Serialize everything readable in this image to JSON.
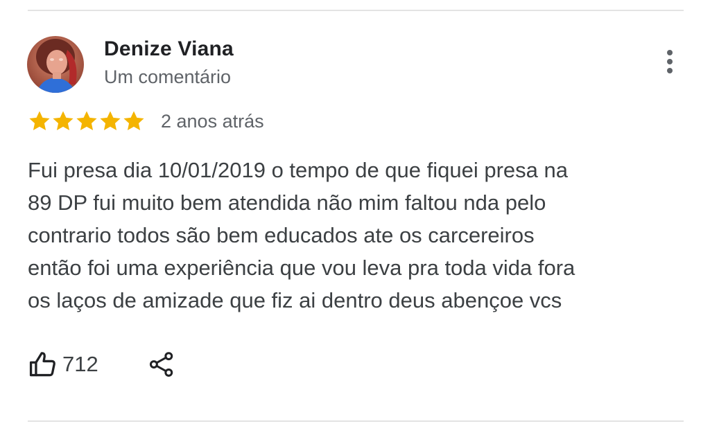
{
  "review": {
    "author": {
      "name": "Denize Viana",
      "meta": "Um comentário",
      "avatar_icon": "user-avatar-photo"
    },
    "rating": 5,
    "rating_max": 5,
    "time": "2 anos atrás",
    "text_lines": [
      "Fui presa dia 10/01/2019 o tempo de que fiquei presa na",
      "89 DP fui muito bem atendida não mim faltou nda pelo",
      "contrario todos são bem educados ate os carcereiros",
      "então foi uma experiência que vou leva pra toda vida fora",
      "os laços de amizade que fiz ai dentro deus abençoe vcs"
    ],
    "likes": "712",
    "icons": {
      "more": "more-vert-icon",
      "like": "thumb-up-icon",
      "share": "share-icon",
      "star": "star-icon"
    }
  },
  "colors": {
    "star": "#f4b400",
    "text_primary": "#202124",
    "text_secondary": "#5f6368",
    "divider": "#e3e3e3"
  }
}
